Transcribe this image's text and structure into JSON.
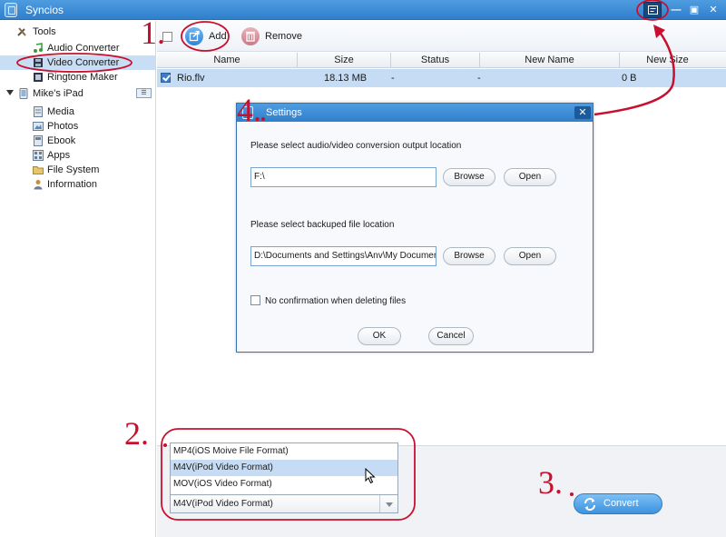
{
  "window": {
    "title": "Syncios"
  },
  "sidebar": {
    "tools_label": "Tools",
    "tools_items": [
      "Audio Converter",
      "Video Converter",
      "Ringtone Maker"
    ],
    "device_label": "Mike's iPad",
    "device_items": [
      "Media",
      "Photos",
      "Ebook",
      "Apps",
      "File System",
      "Information"
    ]
  },
  "toolbar": {
    "add_label": "Add",
    "remove_label": "Remove"
  },
  "table": {
    "columns": [
      "Name",
      "Size",
      "Status",
      "New Name",
      "New Size"
    ],
    "rows": [
      {
        "name": "Rio.flv",
        "size": "18.13 MB",
        "status": "-",
        "new_name": "-",
        "new_size": "0 B"
      }
    ]
  },
  "settings_dialog": {
    "title": "Settings",
    "output_label": "Please select audio/video conversion output location",
    "output_path": "F:\\",
    "backup_label": "Please select backuped file location",
    "backup_path": "D:\\Documents and Settings\\Anv\\My Documents",
    "browse_label": "Browse",
    "open_label": "Open",
    "confirm_label": "No confirmation when deleting files",
    "ok_label": "OK",
    "cancel_label": "Cancel"
  },
  "format": {
    "options": [
      "MP4(iOS Moive File Format)",
      "M4V(iPod Video Format)",
      "MOV(iOS Video Format)"
    ],
    "selected": "M4V(iPod Video Format)"
  },
  "convert_label": "Convert",
  "annotations": [
    "1.",
    "2.",
    "3.",
    "4."
  ],
  "colors": {
    "accent": "#2f7fcc",
    "selection": "#c6dcf4",
    "annotation": "#c8102e"
  }
}
